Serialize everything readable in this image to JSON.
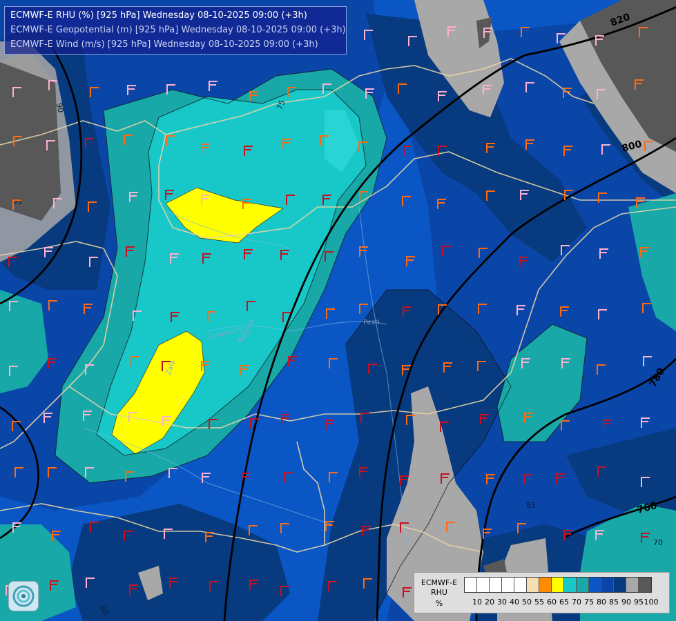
{
  "header": {
    "line1": "ECMWF-E RHU (%) [925 hPa] Wednesday 08-10-2025 09:00 (+3h)",
    "line2": "ECMWF-E Geopotential (m) [925 hPa] Wednesday 08-10-2025 09:00 (+3h)",
    "line3": "ECMWF-E Wind (m/s) [925 hPa] Wednesday 08-10-2025 09:00 (+3h)"
  },
  "legend": {
    "model": "ECMWF-E",
    "variable": "RHU",
    "unit": "%",
    "ticks": [
      "10",
      "20",
      "30",
      "40",
      "50",
      "55",
      "60",
      "65",
      "70",
      "75",
      "80",
      "85",
      "90",
      "95",
      "100"
    ],
    "colors": [
      "#ffffff",
      "#ffffff",
      "#ffffff",
      "#ffffff",
      "#ffffff",
      "#f5deb3",
      "#ff8c00",
      "#ffff00",
      "#18c8c8",
      "#18a8a8",
      "#0a56c4",
      "#0a46a8",
      "#073a7e",
      "#a8a8a8",
      "#585858"
    ]
  },
  "map_labels": {
    "geopotential": [
      "820",
      "800",
      "780",
      "760"
    ],
    "rhu": [
      "95",
      "90",
      "85",
      "75",
      "70",
      "80"
    ],
    "places": [
      "Zala",
      "Graniczny",
      "Balaton",
      "Pesti"
    ]
  },
  "colors": {
    "rh_95": "#585858",
    "rh_90": "#a8a8a8",
    "rh_85": "#073a7e",
    "rh_80": "#0a46a8",
    "rh_75": "#0a56c4",
    "rh_70": "#18a8a8",
    "rh_65": "#18c8c8",
    "rh_60": "#ffff00",
    "wind_low": "#ffb0d0",
    "wind_mid": "#ff6a10",
    "wind_high": "#c81020"
  }
}
